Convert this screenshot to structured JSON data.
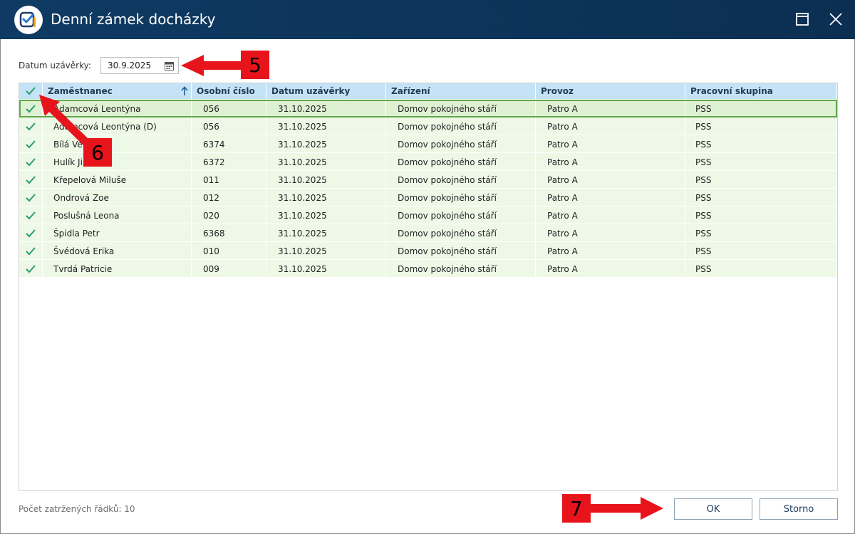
{
  "window": {
    "title": "Denní zámek docházky",
    "icons": [
      "app-check-icon",
      "maximize-icon",
      "close-icon"
    ]
  },
  "filter": {
    "date_label": "Datum uzávěrky:",
    "date_value": "30.9.2025",
    "date_icon": "calendar-icon"
  },
  "grid": {
    "columns": [
      "Zaměstnanec",
      "Osobní číslo",
      "Datum uzávěrky",
      "Zařízení",
      "Provoz",
      "Pracovní skupina"
    ],
    "header_check_icon": "check-icon",
    "sort_icon": "sort-ascending-icon",
    "rows": [
      {
        "name": "Adamcová Leontýna",
        "number": "056",
        "date": "31.10.2025",
        "facility": "Domov pokojného stáří",
        "operation": "Patro A",
        "group": "PSS"
      },
      {
        "name": "Adamcová Leontýna (D)",
        "number": "056",
        "date": "31.10.2025",
        "facility": "Domov pokojného stáří",
        "operation": "Patro A",
        "group": "PSS"
      },
      {
        "name": "Bílá Vera",
        "number": "6374",
        "date": "31.10.2025",
        "facility": "Domov pokojného stáří",
        "operation": "Patro A",
        "group": "PSS"
      },
      {
        "name": "Hulík Jiří",
        "number": "6372",
        "date": "31.10.2025",
        "facility": "Domov pokojného stáří",
        "operation": "Patro A",
        "group": "PSS"
      },
      {
        "name": "Křepelová Miluše",
        "number": "011",
        "date": "31.10.2025",
        "facility": "Domov pokojného stáří",
        "operation": "Patro A",
        "group": "PSS"
      },
      {
        "name": "Ondrová Zoe",
        "number": "012",
        "date": "31.10.2025",
        "facility": "Domov pokojného stáří",
        "operation": "Patro A",
        "group": "PSS"
      },
      {
        "name": "Poslušná Leona",
        "number": "020",
        "date": "31.10.2025",
        "facility": "Domov pokojného stáří",
        "operation": "Patro A",
        "group": "PSS"
      },
      {
        "name": "Špidla Petr",
        "number": "6368",
        "date": "31.10.2025",
        "facility": "Domov pokojného stáří",
        "operation": "Patro A",
        "group": "PSS"
      },
      {
        "name": "Švédová Erika",
        "number": "010",
        "date": "31.10.2025",
        "facility": "Domov pokojného stáří",
        "operation": "Patro A",
        "group": "PSS"
      },
      {
        "name": "Tvrdá Patricie",
        "number": "009",
        "date": "31.10.2025",
        "facility": "Domov pokojného stáří",
        "operation": "Patro A",
        "group": "PSS"
      }
    ]
  },
  "footer": {
    "count_text": "Počet zatržených řádků: 10",
    "ok_label": "OK",
    "cancel_label": "Storno"
  },
  "annotations": {
    "badge_5": "5",
    "badge_6": "6",
    "badge_7": "7"
  },
  "colors": {
    "titlebar": "#0f3a63",
    "header_bg": "#c5e3f6",
    "row_bg": "#eef8e7",
    "check": "#2a9d6f",
    "annotation_red": "#e8141b"
  }
}
